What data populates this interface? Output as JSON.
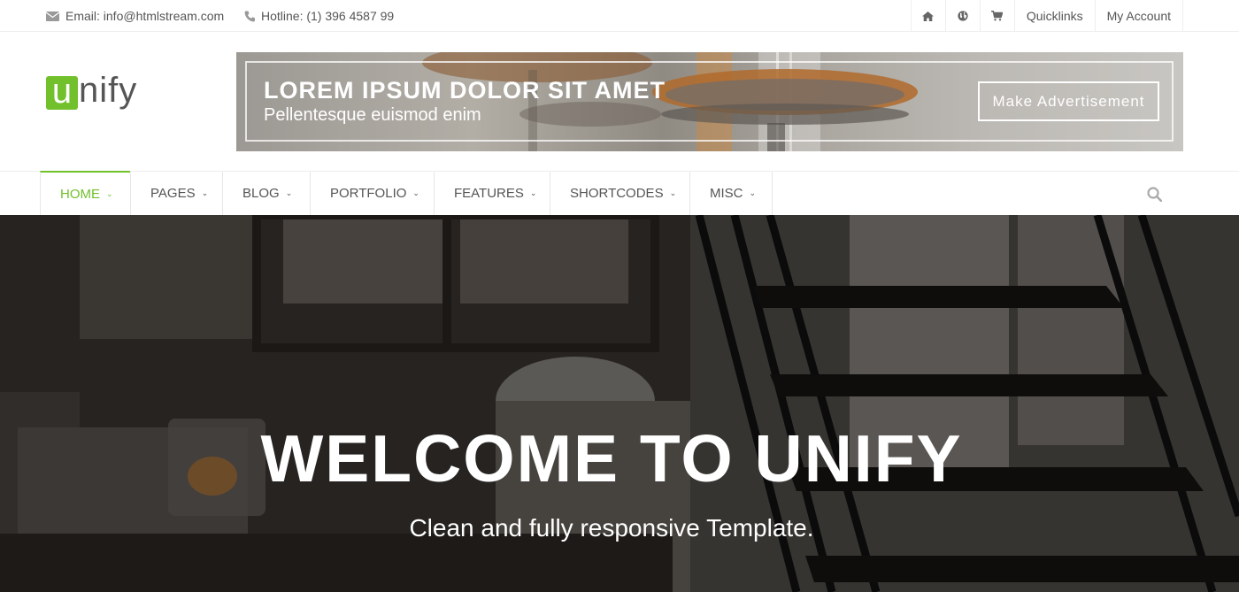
{
  "topbar": {
    "email": "Email: info@htmlstream.com",
    "hotline": "Hotline: (1) 396 4587 99",
    "icons": [
      "home-icon",
      "globe-icon",
      "cart-icon"
    ],
    "quicklinks": "Quicklinks",
    "account": "My Account"
  },
  "logo": {
    "first_letter": "u",
    "rest": "nify"
  },
  "banner": {
    "title": "LOREM IPSUM DOLOR SIT AMET",
    "subtitle": "Pellentesque euismod enim",
    "cta": "Make Advertisement"
  },
  "nav": {
    "items": [
      {
        "label": "HOME",
        "active": true
      },
      {
        "label": "PAGES",
        "active": false
      },
      {
        "label": "BLOG",
        "active": false
      },
      {
        "label": "PORTFOLIO",
        "active": false
      },
      {
        "label": "FEATURES",
        "active": false
      },
      {
        "label": "SHORTCODES",
        "active": false
      },
      {
        "label": "MISC",
        "active": false
      }
    ],
    "chevron": "⌄",
    "search_icon": "search-icon"
  },
  "hero": {
    "headline": "WELCOME TO UNIFY",
    "tagline": "Clean and fully responsive Template."
  },
  "colors": {
    "accent": "#72c02c",
    "text": "#555555"
  }
}
